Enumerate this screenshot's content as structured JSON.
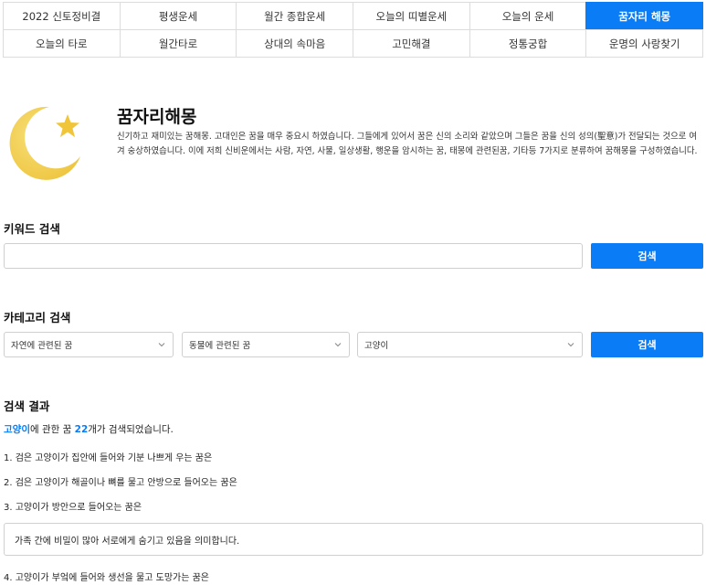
{
  "nav": {
    "row1": [
      "2022 신토정비결",
      "평생운세",
      "월간 종합운세",
      "오늘의 띠별운세",
      "오늘의 운세",
      "꿈자리 해몽"
    ],
    "row2": [
      "오늘의 타로",
      "월간타로",
      "상대의 속마음",
      "고민해결",
      "정통궁합",
      "운명의 사랑찾기"
    ],
    "active": "꿈자리 해몽"
  },
  "intro": {
    "title": "꿈자리해몽",
    "description": "신기하고 재미있는 꿈해몽. 고대인은 꿈을 매우 중요시 하였습니다. 그들에게 있어서 꿈은 신의 소리와 같았으며 그들은 꿈을 신의 성의(聖意)가 전달되는 것으로 여겨 숭상하였습니다. 이에 저희 신비운에서는 사람, 자연, 사물, 일상생활, 행운을 암시하는 꿈, 태몽에 관련된꿈, 기타등 7가지로 분류하여 꿈해몽을 구성하였습니다.",
    "icon": "moon-star-icon",
    "colors": {
      "moon": "#f3d35a",
      "star": "#f0c53a"
    }
  },
  "keyword_search": {
    "title": "키워드 검색",
    "value": "",
    "button": "검색"
  },
  "category_search": {
    "title": "카테고리 검색",
    "selects": [
      "자연에 관련된 꿈",
      "동물에 관련된 꿈",
      "고양이"
    ],
    "button": "검색"
  },
  "results": {
    "title": "검색 결과",
    "keyword": "고양이",
    "summary_mid": "에 관한 꿈 ",
    "count": "22",
    "summary_end": "개가 검색되었습니다.",
    "items": [
      "1. 검은 고양이가 집안에 들어와 기분 나쁘게 우는 꿈은",
      "2. 검은 고양이가 해골이나 뼈를 물고 안방으로 들어오는 꿈은",
      "3. 고양이가 방안으로 들어오는 꿈은",
      "4. 고양이가 부엌에 들어와 생선을 물고 도망가는 꿈은"
    ],
    "expanded_answer": "가족 간에 비밀이 많아 서로에게 숨기고 있음을 의미합니다."
  },
  "colors": {
    "accent": "#0a7cf5",
    "border": "#d0d0d0"
  }
}
